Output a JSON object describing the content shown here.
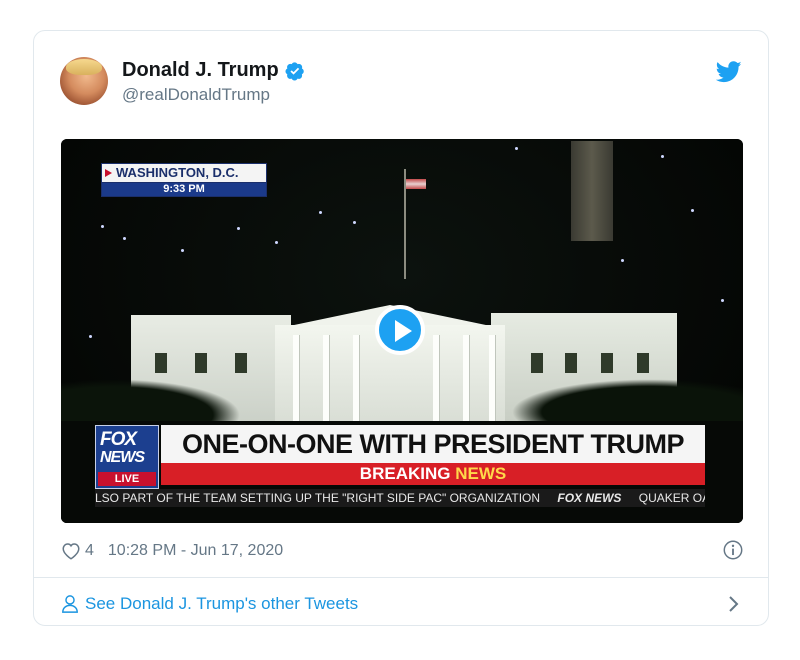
{
  "author": {
    "display_name": "Donald J. Trump",
    "handle": "@realDonaldTrump",
    "verified_icon": "verified-badge-icon",
    "avatar_alt": "profile-photo"
  },
  "brand_icon": "twitter-bird-icon",
  "video": {
    "location": "WASHINGTON, D.C.",
    "local_time": "9:33 PM",
    "network_logo_line1": "FOX",
    "network_logo_line2": "NEWS",
    "live_label": "LIVE",
    "headline": "ONE-ON-ONE WITH PRESIDENT TRUMP",
    "banner_part1": "BREAKING",
    "banner_part2": "NEWS",
    "ticker": {
      "item1": "LSO PART OF THE TEAM SETTING UP THE \"RIGHT SIDE PAC\" ORGANIZATION",
      "brand": "FOX NEWS",
      "item2": "QUAKER OATS"
    },
    "play_icon": "play-icon"
  },
  "meta": {
    "like_count": "4",
    "timestamp": "10:28 PM - Jun 17, 2020",
    "info_icon": "info-icon"
  },
  "footer": {
    "link_text": "See Donald J. Trump's other Tweets",
    "icon": "person-icon",
    "chevron": "chevron-right-icon"
  },
  "colors": {
    "accent": "#1da1f2",
    "link": "#1b95e0",
    "muted": "#657786",
    "border": "#e1e8ed",
    "banner_red": "#d81f26",
    "banner_gold": "#ffd84a",
    "fox_blue": "#1c3f8f"
  }
}
